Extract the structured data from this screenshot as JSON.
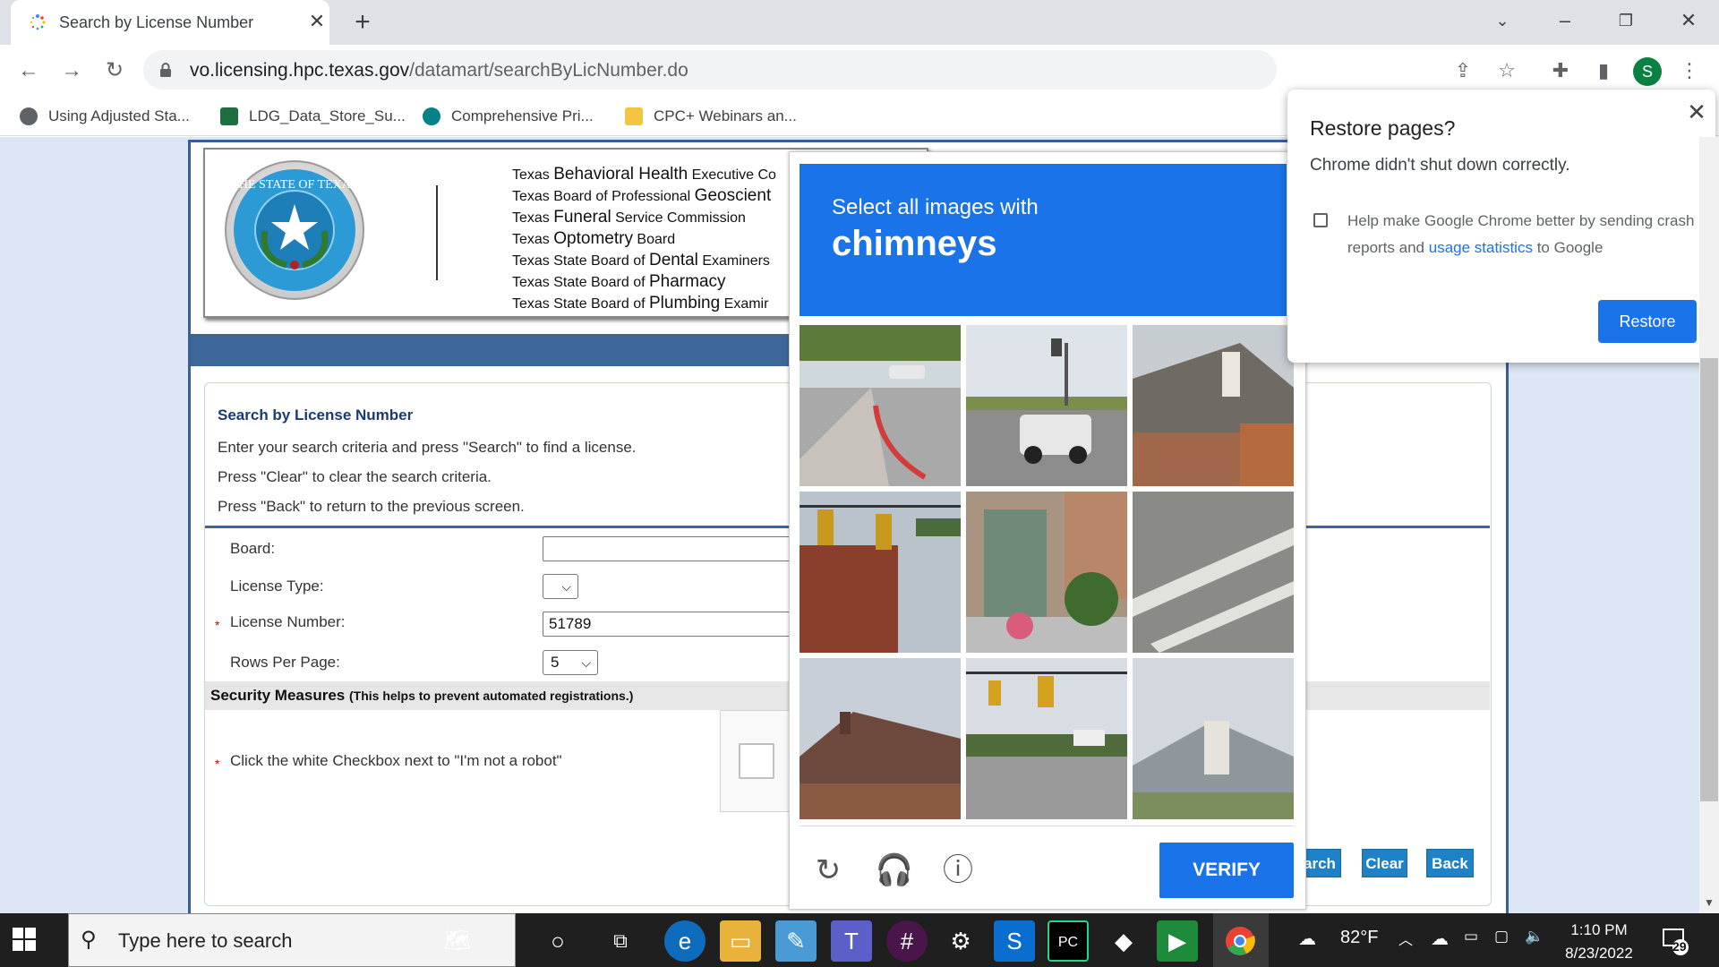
{
  "browser": {
    "tab_title": "Search by License Number",
    "tab_close": "✕",
    "new_tab": "+",
    "url_host": "vo.licensing.hpc.texas.gov",
    "url_path": "/datamart/searchByLicNumber.do",
    "profile_initial": "S",
    "bookmarks": [
      {
        "label": "Using Adjusted Sta...",
        "icon": "globe-icon",
        "color": "#5f6368"
      },
      {
        "label": "LDG_Data_Store_Su...",
        "icon": "excel-icon",
        "color": "#1d6f42"
      },
      {
        "label": "Comprehensive Pri...",
        "icon": "sharepoint-icon",
        "color": "#038387"
      },
      {
        "label": "CPC+ Webinars an...",
        "icon": "folder-icon",
        "color": "#f4c542"
      }
    ]
  },
  "header": {
    "agencies": [
      {
        "prefix": "Texas ",
        "big": "Behavioral Health",
        "suffix": " Executive Co"
      },
      {
        "prefix": "Texas Board of Professional ",
        "big": "Geoscient",
        "suffix": ""
      },
      {
        "prefix": "Texas ",
        "big": "Funeral",
        "suffix": " Service Commission"
      },
      {
        "prefix": "Texas ",
        "big": "Optometry",
        "suffix": " Board"
      },
      {
        "prefix": "Texas State Board of ",
        "big": "Dental",
        "suffix": " Examiners"
      },
      {
        "prefix": "Texas State Board of ",
        "big": "Pharmacy",
        "suffix": ""
      },
      {
        "prefix": "Texas State Board of ",
        "big": "Plumbing",
        "suffix": " Examir"
      }
    ]
  },
  "form": {
    "title": "Search by License Number",
    "instructions": [
      "Enter your search criteria and press \"Search\" to find a license.",
      "Press \"Clear\" to clear the search criteria.",
      "Press \"Back\" to return to the previous screen."
    ],
    "board_label": "Board:",
    "license_type_label": "License Type:",
    "license_number_label": "License Number:",
    "license_number_value": "51789",
    "rows_label": "Rows Per Page:",
    "rows_value": "5",
    "required_mark": "*",
    "security_title": "Security Measures",
    "security_note": "(This helps to prevent automated registrations.)",
    "robot_instruction": "Click the white Checkbox next to \"I'm not a robot\"",
    "search_btn": "arch",
    "clear_btn": "Clear",
    "back_btn": "Back"
  },
  "captcha": {
    "prompt_small": "Select all images with",
    "prompt_big": "chimneys",
    "verify": "VERIFY",
    "tiles": [
      "road-corner",
      "street-suv",
      "house-roof-chimney",
      "traffic-light-building",
      "storefront-shrubs",
      "road-markings",
      "house-roof",
      "intersection-signals",
      "house-chimney"
    ]
  },
  "restore": {
    "title": "Restore pages?",
    "message": "Chrome didn't shut down correctly.",
    "help_pre": "Help make Google Chrome better by sending crash reports and ",
    "help_link": "usage statistics",
    "help_post": " to Google",
    "button": "Restore",
    "close": "✕"
  },
  "taskbar": {
    "search_placeholder": "Type here to search",
    "temperature": "82°F",
    "time": "1:10 PM",
    "date": "8/23/2022",
    "notifications": "29"
  }
}
